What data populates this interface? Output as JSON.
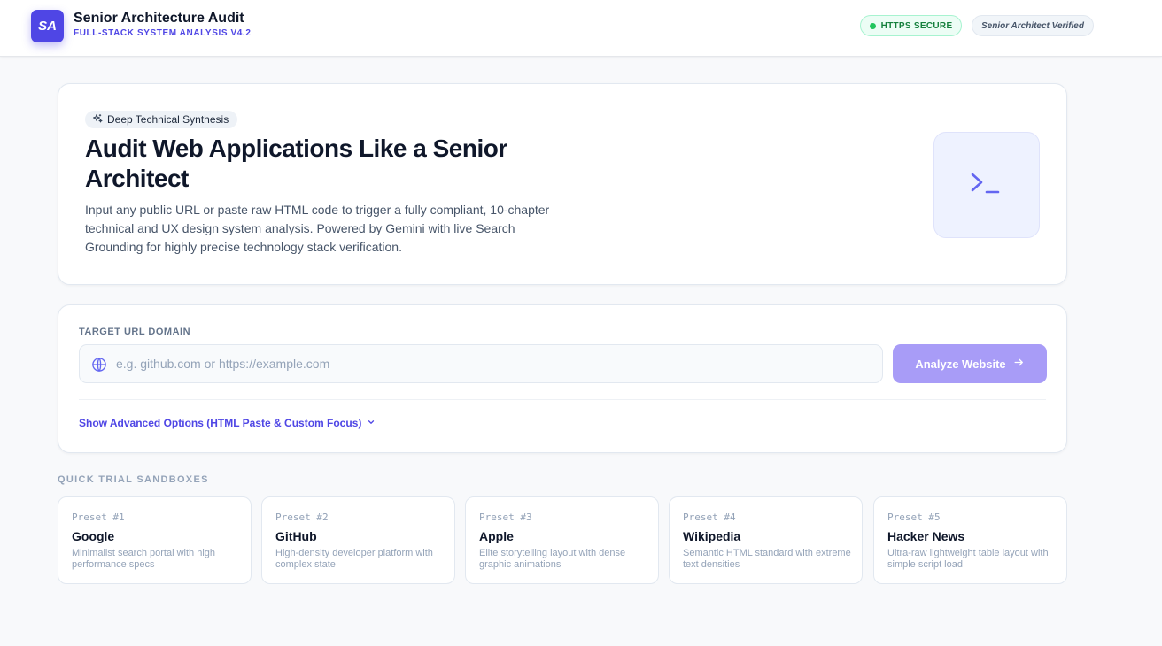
{
  "header": {
    "logo_text": "SA",
    "title": "Senior Architecture Audit",
    "subtitle": "FULL-STACK SYSTEM ANALYSIS V4.2",
    "badge_secure": "HTTPS SECURE",
    "badge_verified": "Senior Architect Verified"
  },
  "hero": {
    "pill": "Deep Technical Synthesis",
    "pill_icon": "sparkles-icon",
    "heading": "Audit Web Applications Like a Senior Architect",
    "description": "Input any public URL or paste raw HTML code to trigger a fully compliant, 10-chapter technical and UX design system analysis. Powered by Gemini with live Search Grounding for highly precise technology stack verification.",
    "illustration_icon": "terminal-icon"
  },
  "form": {
    "label": "TARGET URL DOMAIN",
    "url_value": "",
    "url_placeholder": "e.g. github.com or https://example.com",
    "analyze_label": "Analyze Website",
    "advanced_label": "Show Advanced Options (HTML Paste & Custom Focus)"
  },
  "sandboxes": {
    "label": "QUICK TRIAL SANDBOXES",
    "presets": [
      {
        "num": "Preset #1",
        "name": "Google",
        "desc": "Minimalist search portal with high performance specs"
      },
      {
        "num": "Preset #2",
        "name": "GitHub",
        "desc": "High-density developer platform with complex state"
      },
      {
        "num": "Preset #3",
        "name": "Apple",
        "desc": "Elite storytelling layout with dense graphic animations"
      },
      {
        "num": "Preset #4",
        "name": "Wikipedia",
        "desc": "Semantic HTML standard with extreme text densities"
      },
      {
        "num": "Preset #5",
        "name": "Hacker News",
        "desc": "Ultra-raw lightweight table layout with simple script load"
      }
    ]
  },
  "colors": {
    "accent": "#4f46e5",
    "button_disabled": "#a89cf7",
    "secure_green": "#22c55e"
  }
}
